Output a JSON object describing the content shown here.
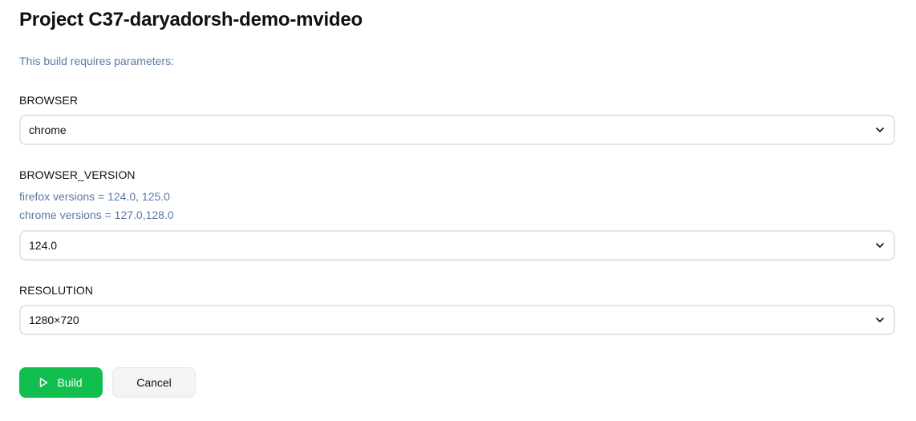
{
  "title": "Project C37-daryadorsh-demo-mvideo",
  "intro": "This build requires parameters:",
  "fields": {
    "browser": {
      "label": "BROWSER",
      "value": "chrome",
      "icon": "chevron-down-icon"
    },
    "browser_version": {
      "label": "BROWSER_VERSION",
      "help_lines": [
        "firefox versions = 124.0, 125.0",
        "chrome versions = 127.0,128.0"
      ],
      "value": "124.0",
      "icon": "chevron-down-icon"
    },
    "resolution": {
      "label": "RESOLUTION",
      "value": "1280×720",
      "icon": "chevron-down-icon"
    }
  },
  "actions": {
    "build_label": "Build",
    "build_icon": "play-icon",
    "cancel_label": "Cancel"
  },
  "colors": {
    "accent": "#11bf4e",
    "help_text": "#5b7aa6",
    "border": "#e2e5ec"
  }
}
